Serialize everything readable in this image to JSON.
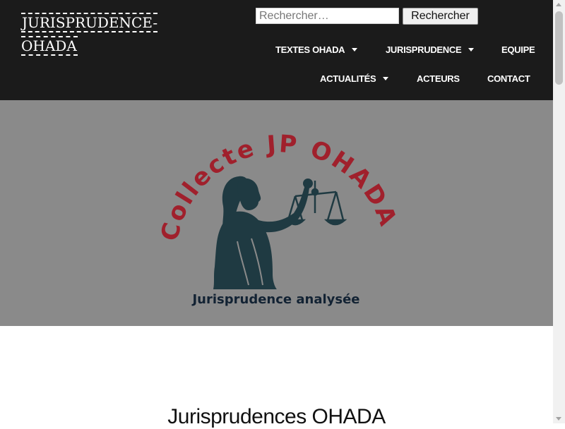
{
  "site": {
    "title": "JURISPRUDENCE-OHADA"
  },
  "search": {
    "placeholder": "Rechercher…",
    "button_label": "Rechercher"
  },
  "nav": {
    "textes_ohada": "TEXTES OHADA",
    "jurisprudence": "JURISPRUDENCE",
    "equipe": "EQUIPE",
    "actualites": "ACTUALITÉS",
    "acteurs": "ACTEURS",
    "contact": "CONTACT"
  },
  "hero": {
    "logo_arc_text": "Collecte JP OHADA",
    "logo_caption": "Jurisprudence analysée",
    "colors": {
      "background": "#8a8a8a",
      "arc_text": "#a0202c",
      "figure": "#1f3a42",
      "caption": "#122233"
    }
  },
  "main": {
    "heading": "Jurisprudences OHADA"
  },
  "colors": {
    "header_bg": "#1b1b1b",
    "header_text": "#ffffff"
  }
}
